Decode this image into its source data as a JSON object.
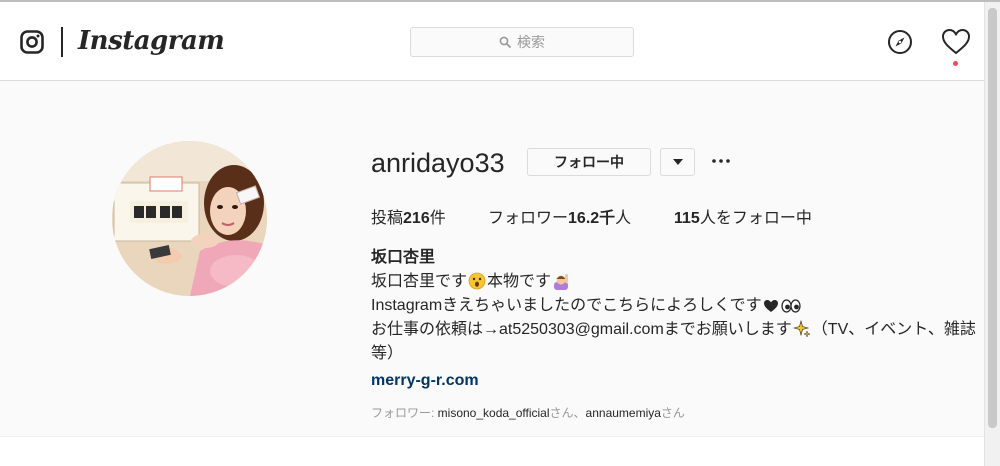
{
  "header": {
    "brand": "Instagram",
    "search_placeholder": "検索",
    "icons": [
      "instagram-camera-icon",
      "search-icon",
      "compass-icon",
      "heart-icon"
    ]
  },
  "profile": {
    "username": "anridayo33",
    "follow_button": "フォロー中",
    "stats": {
      "posts_prefix": "投稿",
      "posts_count": "216",
      "posts_suffix": "件",
      "followers_prefix": "フォロワー",
      "followers_count": "16.2千",
      "followers_suffix": "人",
      "following_count": "115",
      "following_suffix": "人をフォロー中"
    },
    "bio": {
      "full_name": "坂口杏里",
      "line1_a": "坂口杏里です",
      "line1_b": "本物です",
      "line2": "Instagramきえちゃいましたのでこちらによろしくです",
      "line3_a": "お仕事の依頼は→at5250303@gmail.comまでお願いします",
      "line3_b": "（TV、イベント、雑誌",
      "line4": "等）",
      "link": "merry-g-r.com"
    },
    "followed_by": {
      "label": "フォロワー: ",
      "user1": "misono_koda_official",
      "sep1": "さん、",
      "user2": "annaumemiya",
      "sep2": "さん"
    }
  },
  "colors": {
    "text": "#262626",
    "muted": "#999999",
    "link": "#003569",
    "border": "#dbdbdb",
    "background": "#fafafa",
    "notification": "#ed4956"
  }
}
